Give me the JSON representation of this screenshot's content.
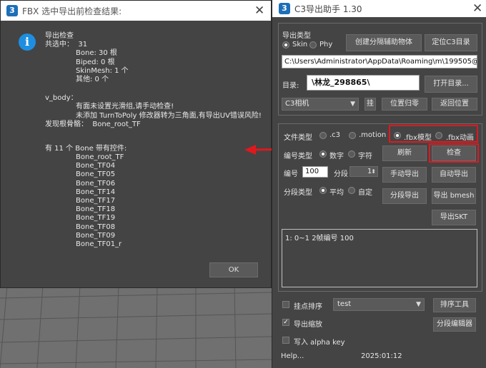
{
  "colors": {
    "accent_red": "#e0181e",
    "info_blue": "#1e8fe0",
    "panel_bg": "#444444"
  },
  "fbx_dialog": {
    "logo": "3",
    "title": "FBX 选中导出前检查结果:",
    "close_icon": "✕",
    "info_icon": "i",
    "report": {
      "heading": "导出检查",
      "selected": "共选中：  31",
      "bone": "Bone: 30 根",
      "biped": "Biped: 0 根",
      "skinmesh": "SkinMesh: 1 个",
      "other": "其他: 0 个",
      "v_body": "v_body：",
      "warn1": "有面未设置光滑组,请手动检查!",
      "warn2": "未添加 TurnToPoly 修改器转为三角面,有导出UV错误风险!",
      "root": "发现根骨骼：  Bone_root_TF",
      "controller_title": "有 11 个 Bone 带有控件:",
      "bones": [
        "Bone_root_TF",
        "Bone_TF04",
        "Bone_TF05",
        "Bone_TF06",
        "Bone_TF14",
        "Bone_TF17",
        "Bone_TF18",
        "Bone_TF19",
        "Bone_TF08",
        "Bone_TF09",
        "Bone_TF01_r"
      ]
    },
    "ok_label": "OK"
  },
  "panel": {
    "logo": "3",
    "title": "C3导出助手 1.30",
    "close_icon": "✕",
    "export_type_label": "导出类型",
    "skin_label": "Skin",
    "phy_label": "Phy",
    "create_helper_btn": "创建分隔辅助物体",
    "locate_c3_btn": "定位C3目录",
    "path_value": "C:\\Users\\Administrator\\AppData\\Roaming\\m\\199505@nd\\Re",
    "dir_label": "目录:",
    "dir_value": "\\林龙_298865\\",
    "open_dir_btn": "打开目录...",
    "camera_select": "C3相机",
    "pin_btn": "挂",
    "pos_reset_btn": "位置归零",
    "return_pos_btn": "返回位置",
    "file_type_label": "文件类型",
    "ft_c3": ".c3",
    "ft_motion": ".motion",
    "ft_fbx_model": ".fbx模型",
    "ft_fbx_anim": ".fbx动画",
    "numbering_type_label": "编号类型",
    "num_digit": "数字",
    "num_char": "字符",
    "refresh_btn": "刷新",
    "check_btn": "检查",
    "number_label": "编号",
    "number_value": "100",
    "segment_label": "分段",
    "segment_value": "1",
    "manual_export_btn": "手动导出",
    "auto_export_btn": "自动导出",
    "segment_type_label": "分段类型",
    "seg_even": "平均",
    "seg_custom": "自定",
    "segment_export_btn": "分段导出",
    "export_bmesh_btn": "导出 bmesh",
    "export_skt_btn": "导出SKT",
    "textarea_text": "1: 0~1 2帧编号 100",
    "pick_sort_label": "挂点排序",
    "sort_select": "test",
    "sort_tool_btn": "排序工具",
    "export_scale_label": "导出缩放",
    "segment_editor_btn": "分段编辑器",
    "alpha_key_label": "写入 alpha key",
    "help_label": "Help...",
    "date_label": "2025:01:12"
  }
}
